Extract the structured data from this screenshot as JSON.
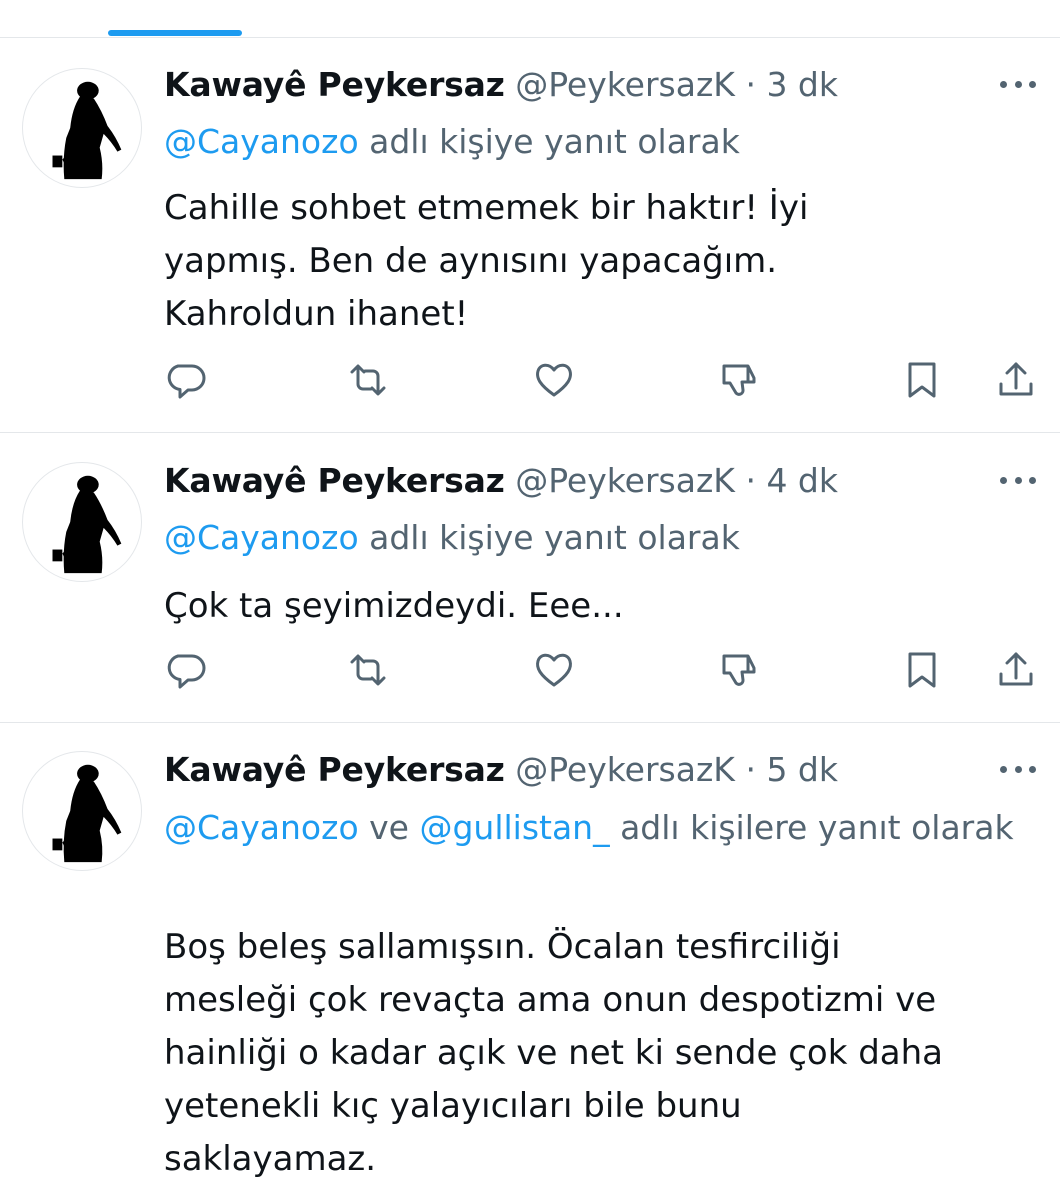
{
  "tweets": [
    {
      "author_name": "Kawayê Peykersaz",
      "author_handle": "@PeykersazK",
      "separator": "·",
      "time": "3 dk",
      "reply_mention_1": "@Cayanozo",
      "reply_connector": "",
      "reply_mention_2": "",
      "reply_suffix": " adlı kişiye yanıt olarak",
      "text_lines": [
        "Cahille sohbet etmemek bir haktır!  İyi",
        "yapmış. Ben de aynısını yapacağım.",
        "Kahroldun ihanet!"
      ]
    },
    {
      "author_name": "Kawayê Peykersaz",
      "author_handle": "@PeykersazK",
      "separator": "·",
      "time": "4 dk",
      "reply_mention_1": "@Cayanozo",
      "reply_connector": "",
      "reply_mention_2": "",
      "reply_suffix": " adlı kişiye yanıt olarak",
      "text_lines": [
        "Çok ta şeyimizdeydi. Eee..."
      ]
    },
    {
      "author_name": "Kawayê Peykersaz",
      "author_handle": "@PeykersazK",
      "separator": "·",
      "time": "5 dk",
      "reply_mention_1": "@Cayanozo",
      "reply_connector": " ve ",
      "reply_mention_2": "@gullistan_",
      "reply_suffix": " adlı kişilere yanıt olarak",
      "text_lines": [
        "Boş beleş sallamışsın. Öcalan tesfirciliği",
        "mesleği çok revaçta ama onun despotizmi ve",
        "hainliği o kadar açık ve net ki sende çok daha",
        "yetenekli kıç yalayıcıları bile bunu",
        "saklayamaz."
      ]
    }
  ],
  "colors": {
    "accent": "#1d9bf0",
    "secondary_text": "#536471",
    "primary_text": "#0f1419",
    "divider": "#e4e7ea"
  },
  "icons": [
    "reply-icon",
    "retweet-icon",
    "like-icon",
    "dislike-icon",
    "bookmark-icon",
    "share-icon",
    "more-icon"
  ]
}
